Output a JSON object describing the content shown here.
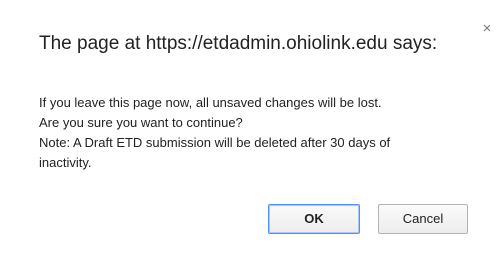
{
  "dialog": {
    "title": "The page at https://etdadmin.ohiolink.edu says:",
    "close_symbol": "×",
    "message_lines": [
      "If you leave this page now, all unsaved changes will be lost.",
      "Are you sure you want to continue?",
      "Note: A Draft ETD submission will be deleted after 30 days of",
      "inactivity."
    ],
    "buttons": {
      "ok_label": "OK",
      "cancel_label": "Cancel"
    }
  },
  "colors": {
    "text": "#222222",
    "ok_border": "#4d90fe",
    "button_border": "#b4b4b4"
  }
}
